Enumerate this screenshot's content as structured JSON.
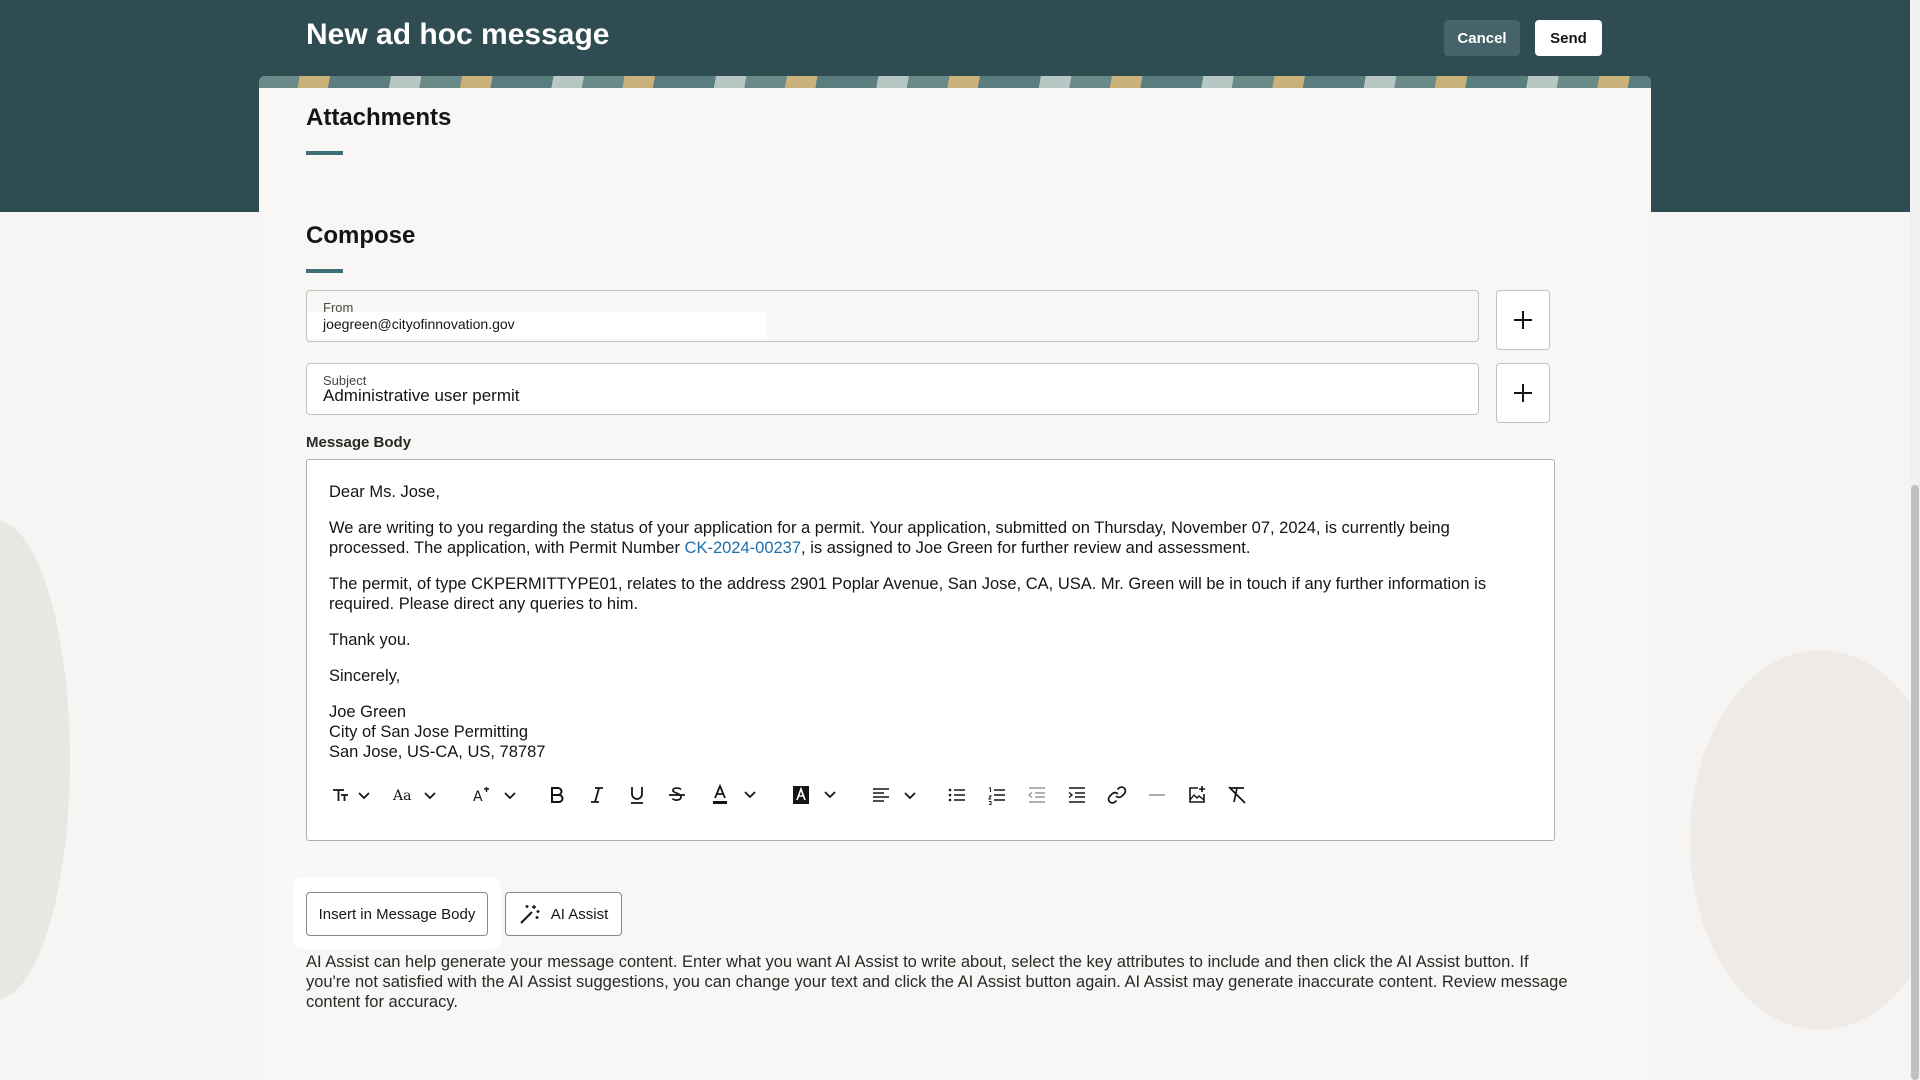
{
  "header": {
    "title": "New ad hoc message",
    "cancel_label": "Cancel",
    "send_label": "Send"
  },
  "sections": {
    "attachments_title": "Attachments",
    "compose_title": "Compose"
  },
  "from": {
    "label": "From",
    "value": "joegreen@cityofinnovation.gov"
  },
  "subject": {
    "label": "Subject",
    "value": "Administrative user permit"
  },
  "message_body": {
    "label": "Message Body",
    "greeting": "Dear Ms. Jose,",
    "p1_before_link": "We are writing to you regarding the status of your application for a permit. Your application, submitted on Thursday, November 07, 2024, is currently being processed. The application, with Permit Number ",
    "permit_link": "CK-2024-00237",
    "p1_after_link": ", is assigned to Joe Green for further review and assessment.",
    "p2": "The permit, of type CKPERMITTYPE01, relates to the address 2901 Poplar Avenue, San Jose, CA, USA. Mr. Green will be in touch if any further information is required. Please direct any queries to him.",
    "thanks": "Thank you.",
    "closing": "Sincerely,",
    "sig_name": "Joe Green",
    "sig_org": "City of San Jose Permitting",
    "sig_addr": "San Jose, US-CA, US, 78787"
  },
  "toolbar": {
    "items": [
      "paragraph-format-icon",
      "font-family-icon",
      "font-size-icon",
      "bold-icon",
      "italic-icon",
      "underline-icon",
      "strikethrough-icon",
      "text-color-icon",
      "highlight-color-icon",
      "align-icon",
      "bullet-list-icon",
      "numbered-list-icon",
      "outdent-icon",
      "indent-icon",
      "link-icon",
      "horizontal-rule-icon",
      "insert-image-icon",
      "clear-format-icon"
    ]
  },
  "actions": {
    "insert_label": "Insert in Message Body",
    "ai_label": "AI Assist"
  },
  "ai_help": "AI Assist can help generate your message content. Enter what you want AI Assist to write about, select the key attributes to include and then click the AI Assist button. If you're not satisfied with the AI Assist suggestions, you can change your text and click the AI Assist button again. AI Assist may generate inaccurate content. Review message content for accuracy.",
  "colors": {
    "header_bg": "#2f4c52",
    "accent": "#3e6e76",
    "link": "#1e6fa8"
  }
}
